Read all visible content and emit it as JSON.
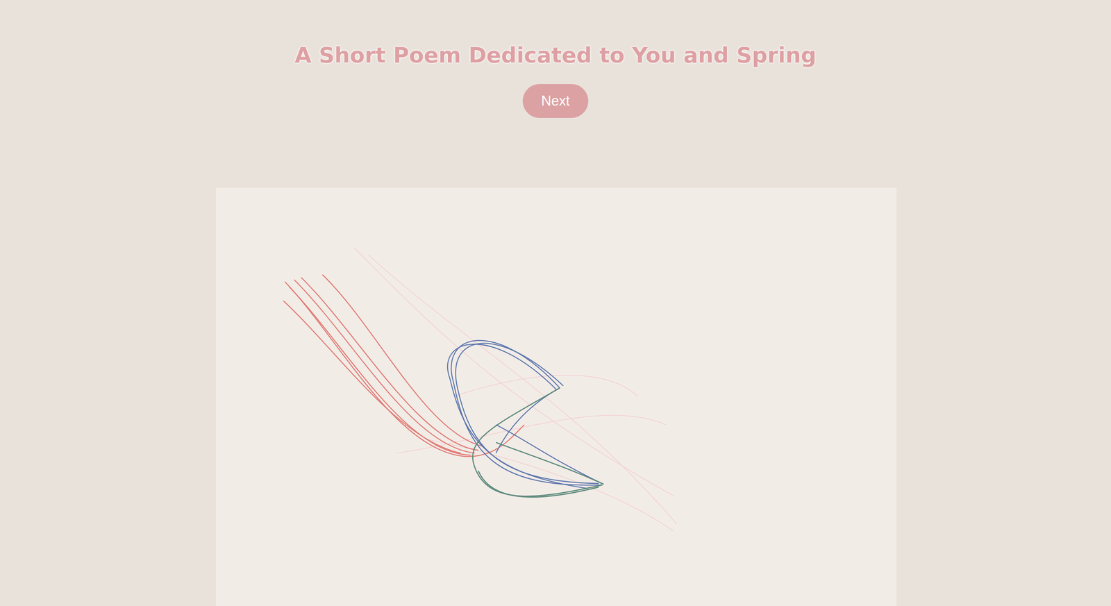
{
  "title": "A Short Poem Dedicated to You and Spring",
  "next_button": {
    "label": "Next"
  }
}
